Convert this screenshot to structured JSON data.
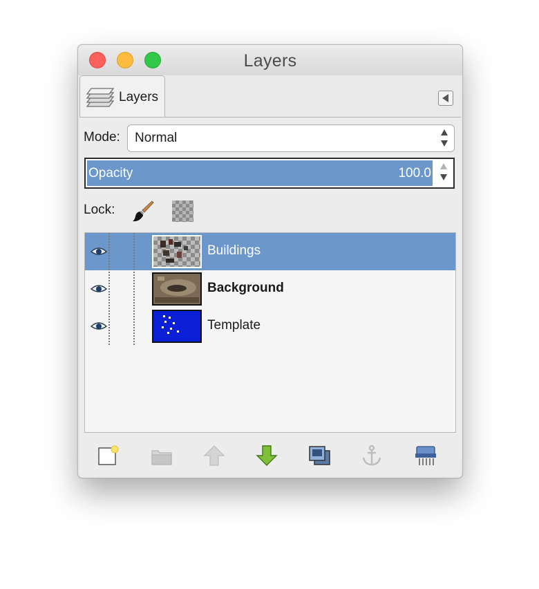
{
  "window": {
    "title": "Layers"
  },
  "tab": {
    "label": "Layers",
    "icon": "layers-icon"
  },
  "mode": {
    "label": "Mode:",
    "value": "Normal"
  },
  "opacity": {
    "label": "Opacity",
    "value": "100.0",
    "level_percent": 100
  },
  "lock": {
    "label": "Lock:",
    "icons": [
      "paintbrush-lock-icon",
      "alpha-lock-icon"
    ]
  },
  "layers": [
    {
      "name": "Buildings",
      "selected": true,
      "bold": false,
      "visible": true
    },
    {
      "name": "Background",
      "selected": false,
      "bold": true,
      "visible": true
    },
    {
      "name": "Template",
      "selected": false,
      "bold": false,
      "visible": true
    }
  ],
  "toolbar": {
    "buttons": [
      "new-layer-icon",
      "new-layer-group-icon",
      "raise-layer-icon",
      "lower-layer-icon",
      "duplicate-layer-icon",
      "anchor-layer-icon",
      "delete-layer-icon"
    ]
  },
  "colors": {
    "selection": "#6b97cb",
    "template_blue": "#0a1fd6",
    "close": "#fc605c",
    "minimize": "#fdbc40",
    "maximize": "#34c84a"
  }
}
